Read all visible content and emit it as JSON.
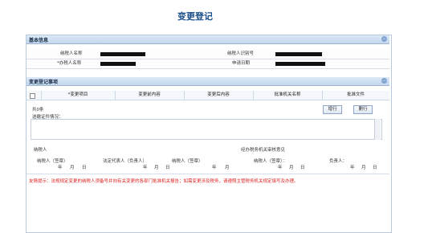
{
  "page": {
    "title": "变更登记"
  },
  "basic_section": {
    "title": "基本信息",
    "collapse_icon": "chevron-up-icon"
  },
  "basic_fields": {
    "taxpayer_name_label": "纳税人名称",
    "taxpayer_id_label": "纳税人识别号",
    "agent_name_label": "*办税人名称",
    "apply_date_label": "申请日期"
  },
  "change_section": {
    "title": "变更登记事项",
    "collapse_icon": "chevron-up-icon"
  },
  "change_table": {
    "columns": [
      "*变更项目",
      "变更前内容",
      "变更后内容",
      "批准机关名称",
      "批准文件"
    ]
  },
  "actions": {
    "row_label": "共0条",
    "add_label": "增行",
    "delete_label": "删行"
  },
  "documents": {
    "label": "送缴证件情况："
  },
  "signatures": {
    "taxpayer_block_label": "纳税人",
    "taxpayer_seal": "纳税人（签章）",
    "legal_rep": "法定代表人（负责人）",
    "taxpayer_seal_2": "纳税人（签章）",
    "tax_office_block_label": "经办税务机关审核意见",
    "taxpayer_seal_3": "纳税人（签章）：",
    "responsible": "负责人：",
    "year": "年",
    "month": "月",
    "day": "日"
  },
  "notice": "友情提示：法规规定变更的纳税人须备号并向有关变更的各部门批准机关报告；如需变更涉及税务，请遵照主管税务机关规定填写及办理。"
}
